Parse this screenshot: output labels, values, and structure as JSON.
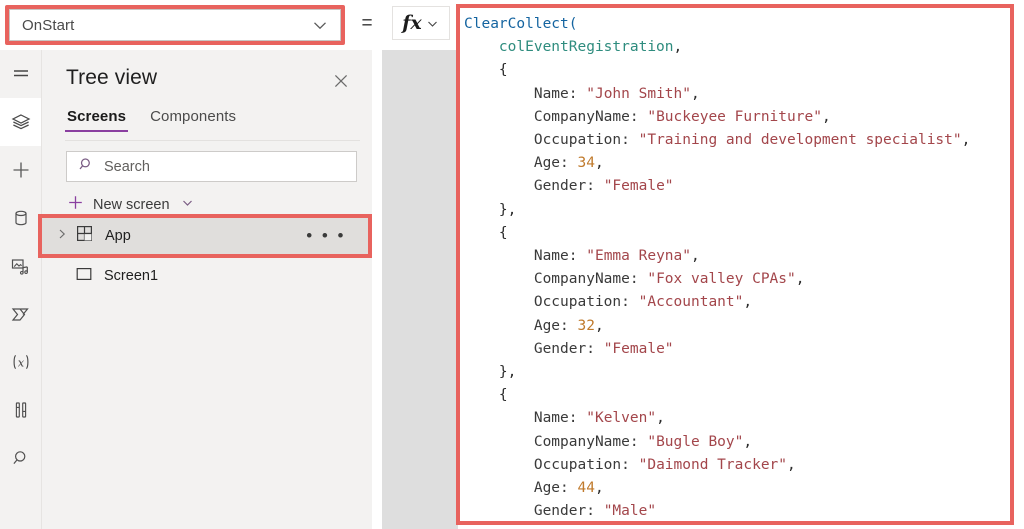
{
  "property_bar": {
    "selected_property": "OnStart",
    "equals_sign": "=",
    "fx_label": "fx",
    "dropdown_icon": "chevron-down-icon",
    "fx_dropdown_icon": "chevron-down-icon"
  },
  "rail": {
    "items": [
      {
        "icon": "hamburger-menu-icon",
        "active": false
      },
      {
        "icon": "layers-tree-view-icon",
        "active": true
      },
      {
        "icon": "plus-insert-icon",
        "active": false
      },
      {
        "icon": "database-data-icon",
        "active": false
      },
      {
        "icon": "media-icon",
        "active": false
      },
      {
        "icon": "power-automate-icon",
        "active": false
      },
      {
        "icon": "variables-x-icon",
        "active": false
      },
      {
        "icon": "settings-tools-icon",
        "active": false
      },
      {
        "icon": "search-icon",
        "active": false
      }
    ]
  },
  "tree_view": {
    "title": "Tree view",
    "close_icon": "close-icon",
    "tabs": [
      {
        "label": "Screens",
        "active": true
      },
      {
        "label": "Components",
        "active": false
      }
    ],
    "search": {
      "placeholder": "Search",
      "value": "",
      "icon": "search-icon"
    },
    "new_screen": {
      "label": "New screen",
      "plus_icon": "plus-icon",
      "chevron_icon": "chevron-down-icon"
    },
    "rows": [
      {
        "label": "App",
        "icon": "app-grid-icon",
        "expand_icon": "chevron-right-icon",
        "overflow": "• • •",
        "selected": true,
        "highlighted": true
      },
      {
        "label": "Screen1",
        "icon": "screen-rectangle-icon",
        "selected": false,
        "highlighted": false
      }
    ]
  },
  "formula_bar": {
    "highlighted": true,
    "lines": [
      [
        {
          "t": "ClearCollect(",
          "c": "fn"
        }
      ],
      [
        {
          "t": "    ",
          "c": "pun"
        },
        {
          "t": "colEventRegistration",
          "c": "var"
        },
        {
          "t": ",",
          "c": "pun"
        }
      ],
      [
        {
          "t": "    {",
          "c": "pun"
        }
      ],
      [
        {
          "t": "        ",
          "c": "pun"
        },
        {
          "t": "Name:",
          "c": "prop"
        },
        {
          "t": " ",
          "c": "pun"
        },
        {
          "t": "\"John Smith\"",
          "c": "str"
        },
        {
          "t": ",",
          "c": "pun"
        }
      ],
      [
        {
          "t": "        ",
          "c": "pun"
        },
        {
          "t": "CompanyName:",
          "c": "prop"
        },
        {
          "t": " ",
          "c": "pun"
        },
        {
          "t": "\"Buckeyee Furniture\"",
          "c": "str"
        },
        {
          "t": ",",
          "c": "pun"
        }
      ],
      [
        {
          "t": "        ",
          "c": "pun"
        },
        {
          "t": "Occupation:",
          "c": "prop"
        },
        {
          "t": " ",
          "c": "pun"
        },
        {
          "t": "\"Training and development specialist\"",
          "c": "str"
        },
        {
          "t": ",",
          "c": "pun"
        }
      ],
      [
        {
          "t": "        ",
          "c": "pun"
        },
        {
          "t": "Age:",
          "c": "prop"
        },
        {
          "t": " ",
          "c": "pun"
        },
        {
          "t": "34",
          "c": "num"
        },
        {
          "t": ",",
          "c": "pun"
        }
      ],
      [
        {
          "t": "        ",
          "c": "pun"
        },
        {
          "t": "Gender:",
          "c": "prop"
        },
        {
          "t": " ",
          "c": "pun"
        },
        {
          "t": "\"Female\"",
          "c": "str"
        }
      ],
      [
        {
          "t": "    },",
          "c": "pun"
        }
      ],
      [
        {
          "t": "    {",
          "c": "pun"
        }
      ],
      [
        {
          "t": "        ",
          "c": "pun"
        },
        {
          "t": "Name:",
          "c": "prop"
        },
        {
          "t": " ",
          "c": "pun"
        },
        {
          "t": "\"Emma Reyna\"",
          "c": "str"
        },
        {
          "t": ",",
          "c": "pun"
        }
      ],
      [
        {
          "t": "        ",
          "c": "pun"
        },
        {
          "t": "CompanyName:",
          "c": "prop"
        },
        {
          "t": " ",
          "c": "pun"
        },
        {
          "t": "\"Fox valley CPAs\"",
          "c": "str"
        },
        {
          "t": ",",
          "c": "pun"
        }
      ],
      [
        {
          "t": "        ",
          "c": "pun"
        },
        {
          "t": "Occupation:",
          "c": "prop"
        },
        {
          "t": " ",
          "c": "pun"
        },
        {
          "t": "\"Accountant\"",
          "c": "str"
        },
        {
          "t": ",",
          "c": "pun"
        }
      ],
      [
        {
          "t": "        ",
          "c": "pun"
        },
        {
          "t": "Age:",
          "c": "prop"
        },
        {
          "t": " ",
          "c": "pun"
        },
        {
          "t": "32",
          "c": "num"
        },
        {
          "t": ",",
          "c": "pun"
        }
      ],
      [
        {
          "t": "        ",
          "c": "pun"
        },
        {
          "t": "Gender:",
          "c": "prop"
        },
        {
          "t": " ",
          "c": "pun"
        },
        {
          "t": "\"Female\"",
          "c": "str"
        }
      ],
      [
        {
          "t": "    },",
          "c": "pun"
        }
      ],
      [
        {
          "t": "    {",
          "c": "pun"
        }
      ],
      [
        {
          "t": "        ",
          "c": "pun"
        },
        {
          "t": "Name:",
          "c": "prop"
        },
        {
          "t": " ",
          "c": "pun"
        },
        {
          "t": "\"Kelven\"",
          "c": "str"
        },
        {
          "t": ",",
          "c": "pun"
        }
      ],
      [
        {
          "t": "        ",
          "c": "pun"
        },
        {
          "t": "CompanyName:",
          "c": "prop"
        },
        {
          "t": " ",
          "c": "pun"
        },
        {
          "t": "\"Bugle Boy\"",
          "c": "str"
        },
        {
          "t": ",",
          "c": "pun"
        }
      ],
      [
        {
          "t": "        ",
          "c": "pun"
        },
        {
          "t": "Occupation:",
          "c": "prop"
        },
        {
          "t": " ",
          "c": "pun"
        },
        {
          "t": "\"Daimond Tracker\"",
          "c": "str"
        },
        {
          "t": ",",
          "c": "pun"
        }
      ],
      [
        {
          "t": "        ",
          "c": "pun"
        },
        {
          "t": "Age:",
          "c": "prop"
        },
        {
          "t": " ",
          "c": "pun"
        },
        {
          "t": "44",
          "c": "num"
        },
        {
          "t": ",",
          "c": "pun"
        }
      ],
      [
        {
          "t": "        ",
          "c": "pun"
        },
        {
          "t": "Gender:",
          "c": "prop"
        },
        {
          "t": " ",
          "c": "pun"
        },
        {
          "t": "\"Male\"",
          "c": "str"
        }
      ]
    ]
  },
  "colors": {
    "highlight_red": "#e8635e",
    "accent_purple": "#8a3fa0",
    "panel_bg": "#f3f2f1",
    "row_selected_bg": "#e0dedc",
    "gutter_bg": "#dedede",
    "token_function": "#1464a0",
    "token_variable": "#2e8c7e",
    "token_string": "#a3464b",
    "token_number": "#c07a2c"
  }
}
